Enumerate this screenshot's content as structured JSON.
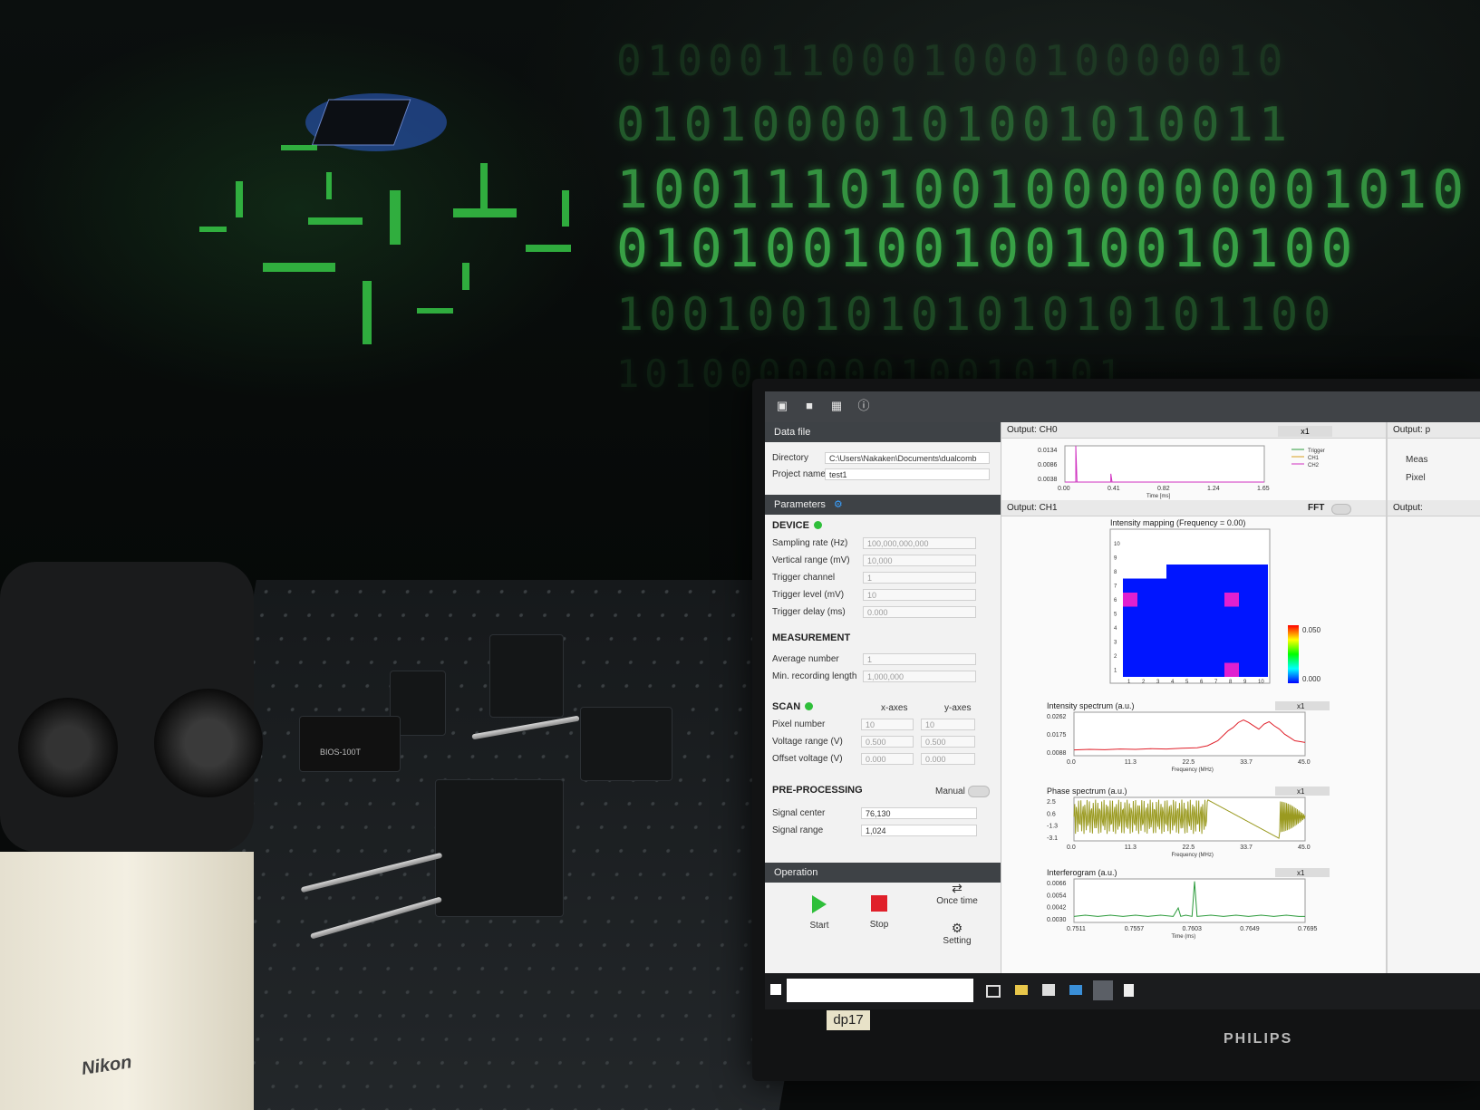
{
  "background": {
    "binary_rows": [
      "0100011000100010000010",
      "01010000101001010011",
      "10011101001000000001010",
      "01010010010010010100",
      "1001001010101010101100",
      "101000000010010101"
    ],
    "brand_text": "PHILIPS",
    "monitor_sticker": "dp17",
    "camera_label": "BIOS-100T",
    "microscope_brand": "Nikon"
  },
  "toolbar": {
    "icons": [
      "new-folder-icon",
      "open-folder-icon",
      "save-icon",
      "info-icon"
    ]
  },
  "data_file": {
    "title": "Data file",
    "directory_label": "Directory",
    "directory_value": "C:\\Users\\Nakaken\\Documents\\dualcomb",
    "project_label": "Project name",
    "project_value": "test1"
  },
  "parameters": {
    "title": "Parameters",
    "device": {
      "title": "DEVICE",
      "rows": [
        {
          "label": "Sampling rate (Hz)",
          "value": "100,000,000,000"
        },
        {
          "label": "Vertical range (mV)",
          "value": "10,000"
        },
        {
          "label": "Trigger channel",
          "value": "1"
        },
        {
          "label": "Trigger level (mV)",
          "value": "10"
        },
        {
          "label": "Trigger delay (ms)",
          "value": "0.000"
        }
      ]
    },
    "measurement": {
      "title": "MEASUREMENT",
      "rows": [
        {
          "label": "Average number",
          "value": "1"
        },
        {
          "label": "Min. recording length",
          "value": "1,000,000"
        }
      ]
    },
    "scan": {
      "title": "SCAN",
      "x_header": "x-axes",
      "y_header": "y-axes",
      "rows": [
        {
          "label": "Pixel number",
          "x": "10",
          "y": "10"
        },
        {
          "label": "Voltage range (V)",
          "x": "0.500",
          "y": "0.500"
        },
        {
          "label": "Offset voltage (V)",
          "x": "0.000",
          "y": "0.000"
        }
      ]
    },
    "preprocessing": {
      "title": "PRE-PROCESSING",
      "manual_label": "Manual",
      "rows": [
        {
          "label": "Signal center",
          "value": "76,130"
        },
        {
          "label": "Signal range",
          "value": "1,024"
        }
      ]
    }
  },
  "operation": {
    "title": "Operation",
    "start_label": "Start",
    "stop_label": "Stop",
    "once_label": "Once time",
    "setting_label": "Setting"
  },
  "outputs": {
    "ch0_title": "Output: CH0",
    "ch1_title": "Output: CH1",
    "fft_label": "FFT",
    "zoom_label": "x1",
    "right_title_1": "Output: p",
    "right_title_2": "Output:",
    "right_meas": "Meas",
    "right_pixel": "Pixel"
  },
  "colors": {
    "binary_green": "#3db14c",
    "panel_dark": "#3e4246",
    "map_blue": "#0015ff",
    "magenta": "#e020d0",
    "spectrum_red": "#e0202a",
    "phase_olive": "#9a9a20",
    "interferogram_green": "#2a9a3a",
    "status_green": "#2fbf3a"
  },
  "chart_data": [
    {
      "type": "line",
      "title": "",
      "xlabel": "Time [ms]",
      "ylabel": "",
      "x_ticks": [
        "0.00",
        "0.41",
        "0.82",
        "1.24",
        "1.65"
      ],
      "y_ticks": [
        "0.0134",
        "0.0086",
        "0.0038"
      ],
      "ylim": [
        0.0038,
        0.0134
      ],
      "xlim": [
        0,
        1.65
      ],
      "legend": [
        "Trigger",
        "CH1",
        "CH2"
      ],
      "legend_colors": [
        "#2a9a3a",
        "#d8a020",
        "#d030c0"
      ],
      "series": [
        {
          "name": "CH2",
          "color": "#d030c0",
          "x": [
            0,
            0.09,
            0.09,
            0.1,
            0.38,
            0.38,
            0.39,
            1.65
          ],
          "y": [
            0.0038,
            0.0038,
            0.0134,
            0.0038,
            0.0038,
            0.006,
            0.0038,
            0.0038
          ]
        }
      ]
    },
    {
      "type": "heatmap",
      "title": "Intensity mapping (Frequency = 0.00)",
      "x_ticks": [
        "1",
        "2",
        "3",
        "4",
        "5",
        "6",
        "7",
        "8",
        "9",
        "10"
      ],
      "y_ticks": [
        "1",
        "2",
        "3",
        "4",
        "5",
        "6",
        "7",
        "8",
        "9",
        "10"
      ],
      "colorbar": [
        "0.050",
        "0.000"
      ],
      "description_cells": {
        "white_region": "rows 8-10 mostly empty",
        "magenta_cells": [
          [
            8,
            6
          ],
          [
            1,
            6
          ],
          [
            8,
            1
          ]
        ]
      }
    },
    {
      "type": "line",
      "title": "Intensity spectrum (a.u.)",
      "xlabel": "Frequency (MHz)",
      "x_ticks": [
        "0.0",
        "11.3",
        "22.5",
        "33.7",
        "45.0"
      ],
      "y_ticks": [
        "0.0262",
        "0.0175",
        "0.0088"
      ],
      "xlim": [
        0,
        45
      ],
      "ylim": [
        0,
        0.0262
      ],
      "series": [
        {
          "name": "",
          "color": "#e0202a",
          "x": [
            0,
            3,
            6,
            9,
            12,
            15,
            18,
            21,
            24,
            26,
            28,
            29,
            30,
            31,
            32,
            33,
            34,
            35,
            36,
            37,
            38,
            39,
            40,
            41,
            42,
            43,
            44,
            45
          ],
          "y": [
            0.0035,
            0.0038,
            0.0036,
            0.004,
            0.0038,
            0.0042,
            0.004,
            0.0045,
            0.0048,
            0.006,
            0.009,
            0.012,
            0.015,
            0.017,
            0.02,
            0.0215,
            0.02,
            0.018,
            0.016,
            0.019,
            0.0205,
            0.018,
            0.016,
            0.013,
            0.011,
            0.009,
            0.0085,
            0.008
          ]
        }
      ]
    },
    {
      "type": "line",
      "title": "Phase spectrum (a.u.)",
      "xlabel": "Frequency (MHz)",
      "x_ticks": [
        "0.0",
        "11.3",
        "22.5",
        "33.7",
        "45.0"
      ],
      "y_ticks": [
        "2.5",
        "0.6",
        "-1.3",
        "-3.1"
      ],
      "xlim": [
        0,
        45
      ],
      "ylim": [
        -3.1,
        2.5
      ],
      "series": [
        {
          "name": "",
          "color": "#9a9a20",
          "x": [
            0,
            45
          ],
          "y": [
            -3.1,
            2.5
          ]
        }
      ]
    },
    {
      "type": "line",
      "title": "Interferogram (a.u.)",
      "xlabel": "Time (ms)",
      "x_ticks": [
        "0.7511",
        "0.7557",
        "0.7603",
        "0.7649",
        "0.7695"
      ],
      "y_ticks": [
        "0.0066",
        "0.0054",
        "0.0042",
        "0.0030"
      ],
      "xlim": [
        0.7511,
        0.7695
      ],
      "ylim": [
        0.003,
        0.0066
      ],
      "series": [
        {
          "name": "",
          "color": "#2a9a3a",
          "x": [
            0.7511,
            0.752,
            0.753,
            0.754,
            0.755,
            0.756,
            0.757,
            0.758,
            0.759,
            0.7594,
            0.7596,
            0.76,
            0.7605,
            0.7607,
            0.7609,
            0.762,
            0.763,
            0.764,
            0.765,
            0.766,
            0.767,
            0.768,
            0.769,
            0.7695
          ],
          "y": [
            0.0035,
            0.0036,
            0.0035,
            0.0036,
            0.0035,
            0.0036,
            0.0035,
            0.0036,
            0.0035,
            0.0042,
            0.0035,
            0.0036,
            0.0035,
            0.0064,
            0.0035,
            0.0036,
            0.0035,
            0.0036,
            0.0035,
            0.0036,
            0.0035,
            0.0036,
            0.0035,
            0.0035
          ]
        }
      ]
    }
  ]
}
